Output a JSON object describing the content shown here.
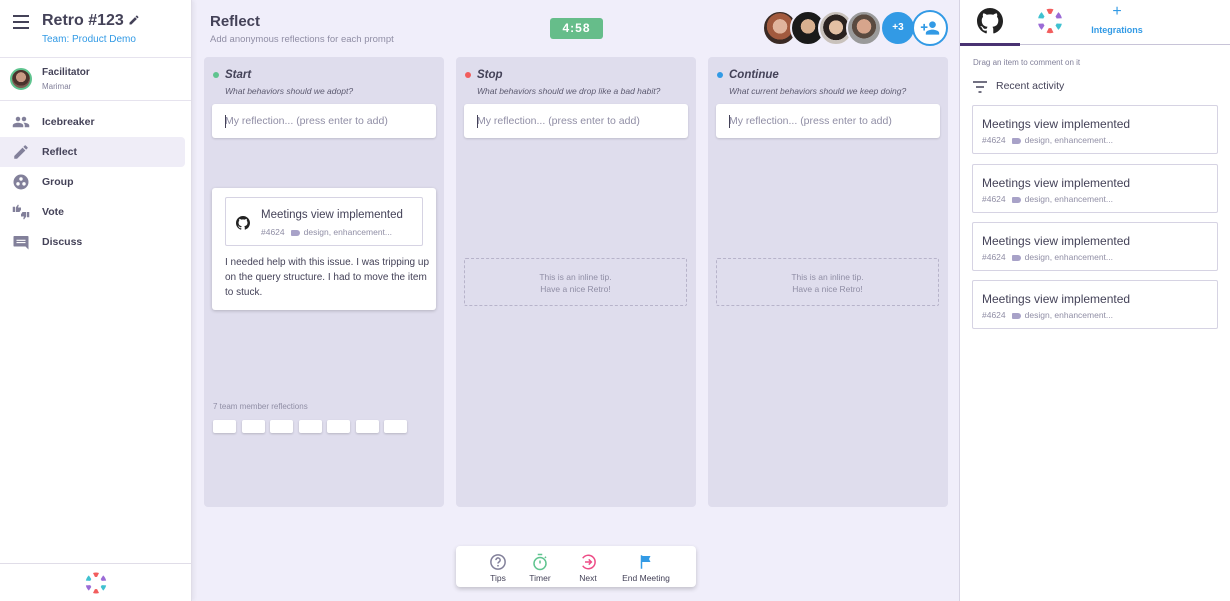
{
  "sidebar": {
    "retro_title": "Retro #123",
    "team_link": "Team: Product Demo",
    "facilitator_label": "Facilitator",
    "facilitator_name": "Marimar",
    "nav": [
      {
        "label": "Icebreaker",
        "icon": "people-icon",
        "active": false
      },
      {
        "label": "Reflect",
        "icon": "pencil-icon",
        "active": true
      },
      {
        "label": "Group",
        "icon": "group-icon",
        "active": false
      },
      {
        "label": "Vote",
        "icon": "thumbs-icon",
        "active": false
      },
      {
        "label": "Discuss",
        "icon": "chat-icon",
        "active": false
      }
    ]
  },
  "header": {
    "title": "Reflect",
    "description": "Add anonymous reflections for each prompt",
    "timer": "4:58",
    "extra_participants": "+3"
  },
  "columns": [
    {
      "title": "Start",
      "question": "What behaviors should we adopt?",
      "dot_color": "#5fc48f",
      "input_placeholder": "My reflection... (press enter to add)"
    },
    {
      "title": "Stop",
      "question": "What behaviors should we drop like a bad habit?",
      "dot_color": "#f25d5d",
      "input_placeholder": "My reflection... (press enter to add)"
    },
    {
      "title": "Continue",
      "question": "What current behaviors should we keep doing?",
      "dot_color": "#329ae5",
      "input_placeholder": "My reflection... (press enter to add)"
    }
  ],
  "reflection_card": {
    "issue_title": "Meetings view implemented",
    "issue_number": "#4624",
    "issue_labels": "design, enhancement...",
    "text": "I needed help with this issue. I was tripping up on the query structure. I had to move the item to stuck."
  },
  "team_reflections": {
    "label": "7 team member reflections",
    "count": 7
  },
  "inline_tip": {
    "line1": "This is an inline tip.",
    "line2": "Have a nice Retro!"
  },
  "bottom_bar": {
    "tips": "Tips",
    "timer": "Timer",
    "next": "Next",
    "end_meeting": "End Meeting"
  },
  "right_panel": {
    "integrations_label": "Integrations",
    "drag_hint": "Drag an item to comment on it",
    "filter_label": "Recent activity",
    "items": [
      {
        "title": "Meetings view implemented",
        "number": "#4624",
        "labels": "design, enhancement..."
      },
      {
        "title": "Meetings view implemented",
        "number": "#4624",
        "labels": "design, enhancement..."
      },
      {
        "title": "Meetings view implemented",
        "number": "#4624",
        "labels": "design, enhancement..."
      },
      {
        "title": "Meetings view implemented",
        "number": "#4624",
        "labels": "design, enhancement..."
      }
    ]
  },
  "colors": {
    "accent_blue": "#329ae5",
    "timer_green": "#66bd8a",
    "primary_purple": "#493272",
    "column_bg": "#dfdded"
  }
}
